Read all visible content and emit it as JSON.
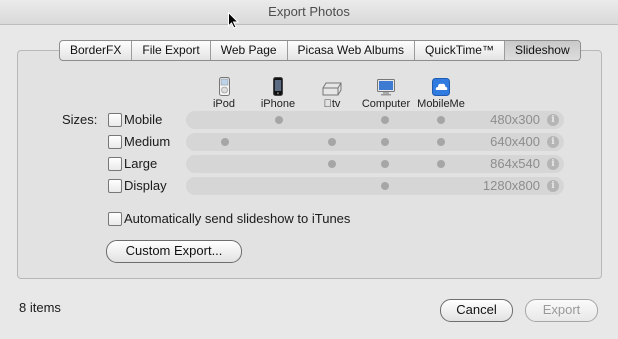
{
  "window": {
    "title": "Export Photos"
  },
  "tabs": [
    {
      "label": "BorderFX"
    },
    {
      "label": "File Export"
    },
    {
      "label": "Web Page"
    },
    {
      "label": "Picasa Web Albums"
    },
    {
      "label": "QuickTime™"
    },
    {
      "label": "Slideshow",
      "active": true
    }
  ],
  "devices": [
    {
      "label": "iPod",
      "icon": "ipod-icon"
    },
    {
      "label": "iPhone",
      "icon": "iphone-icon"
    },
    {
      "label": "tv",
      "icon": "appletv-icon"
    },
    {
      "label": "Computer",
      "icon": "computer-icon"
    },
    {
      "label": "MobileMe",
      "icon": "mobileme-icon"
    }
  ],
  "sizes_label": "Sizes:",
  "sizes": [
    {
      "name": "Mobile",
      "resolution": "480x300",
      "checked": false,
      "devices": [
        "iPhone",
        "Computer",
        "MobileMe"
      ]
    },
    {
      "name": "Medium",
      "resolution": "640x400",
      "checked": false,
      "devices": [
        "iPod",
        "tv",
        "Computer",
        "MobileMe"
      ]
    },
    {
      "name": "Large",
      "resolution": "864x540",
      "checked": false,
      "devices": [
        "tv",
        "Computer",
        "MobileMe"
      ]
    },
    {
      "name": "Display",
      "resolution": "1280x800",
      "checked": false,
      "devices": [
        "Computer"
      ]
    }
  ],
  "auto_send": {
    "label": "Automatically send slideshow to iTunes",
    "checked": false
  },
  "buttons": {
    "custom_export": "Custom Export...",
    "cancel": "Cancel",
    "export": "Export"
  },
  "status": {
    "items": "8 items"
  },
  "colors": {
    "background": "#e8e8e8",
    "dot": "#a6a6a6",
    "disabled_text": "#9a9a9a"
  }
}
